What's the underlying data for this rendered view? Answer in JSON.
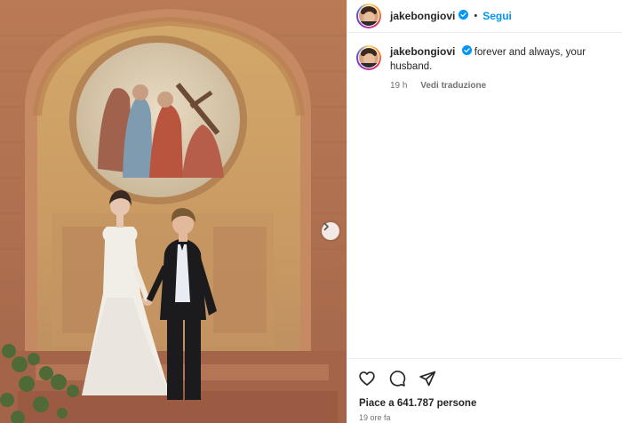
{
  "post": {
    "username": "jakebongiovi",
    "follow_label": "Segui",
    "separator": "•",
    "caption": "forever and always, your husband.",
    "caption_time": "19 h",
    "translate_label": "Vedi traduzione",
    "likes": "Piace a 641.787 persone",
    "posted_ago": "19 ore fa"
  },
  "icons": {
    "like": "heart-icon",
    "comment": "comment-icon",
    "share": "send-icon",
    "carousel": "chevron-right-icon",
    "verified": "verified-badge-icon"
  },
  "colors": {
    "link": "#0095f6",
    "verified": "#0095f6",
    "muted": "#737373",
    "text": "#262626"
  }
}
